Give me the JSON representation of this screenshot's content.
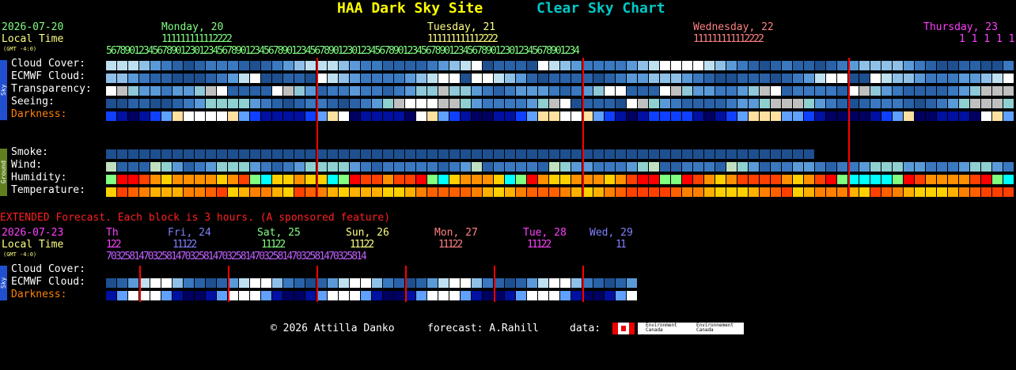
{
  "title": {
    "site": "HAA Dark Sky Site",
    "chart": "Clear Sky Chart"
  },
  "colors": {
    "site": "#ffff00",
    "chart": "#00c8c8",
    "date1": "#80ff80",
    "date2": "#ffff80",
    "date3": "#ff8080",
    "date4": "#ff40ff",
    "red_line": "#ff0000"
  },
  "header": {
    "start_date": "2026-07-20",
    "local_time": "Local Time",
    "gmt": "(GMT -4:0)",
    "days": [
      "Monday, 20",
      "Tuesday, 21",
      "Wednesday, 22",
      "Thursday, 23"
    ],
    "hours_tens": "1 1 1 1 1 1 1 1 1 1 1 2 2 2 2",
    "hours_row": "5 6 7 8 9 0 1 2 3 4 5 6 7 8 9 0 1 2 3 0 1 2 3 4 5 6 7 8 9 0 1 2 3 4 5 6 7 8 9 0 1 2 3 4 5 6 7 8 9 0 1 2 3 0 1 2 3 4 5 6 7 8 9 0 1 2 3 4 5 6 7 8 9 0 1 2 3 4 5 6 7 8 9 0 1 2 3 0 1 2 3 4 5 6 7 8 9 0 1 2 3 4"
  },
  "sky_label": "Sky",
  "ground_label": "Ground",
  "rows": {
    "cloud": "Cloud Cover:",
    "ecmwf": "ECMWF Cloud:",
    "transparency": "Transparency:",
    "seeing": "Seeing:",
    "darkness": "Darkness:",
    "smoke": "Smoke:",
    "wind": "Wind:",
    "humidity": "Humidity:",
    "temperature": "Temperature:"
  },
  "extended": {
    "note": "EXTENDED Forecast. Each block is 3 hours. (A sponsored feature)",
    "start_date": "2026-07-23",
    "local_time": "Local Time",
    "gmt": "(GMT -4:0)",
    "days": [
      "Th",
      "Fri, 24",
      "Sat, 25",
      "Sun, 26",
      "Mon, 27",
      "Tue, 28",
      "Wed, 29"
    ],
    "tens": "1 2 2",
    "hours": "7 0 3 2 5 8 1 4 7 0 3 2 5 8 1 4 7 0 3 2 5 8 1 4 7 0 3 2 5 8 1 4 7 0 3 2 5 8 1 4 7 0 3 2 5 8 1 4 7 0 3 2 5 8 1 4",
    "rows": {
      "cloud": "Cloud Cover:",
      "ecmwf": "ECMWF Cloud:",
      "darkness": "Darkness:"
    }
  },
  "footer": {
    "copyright": "© 2026 Attilla Danko",
    "forecast": "forecast: A.Rahill",
    "data": "data:",
    "ec1": "Environment Canada",
    "ec2": "Environnement Canada"
  }
}
